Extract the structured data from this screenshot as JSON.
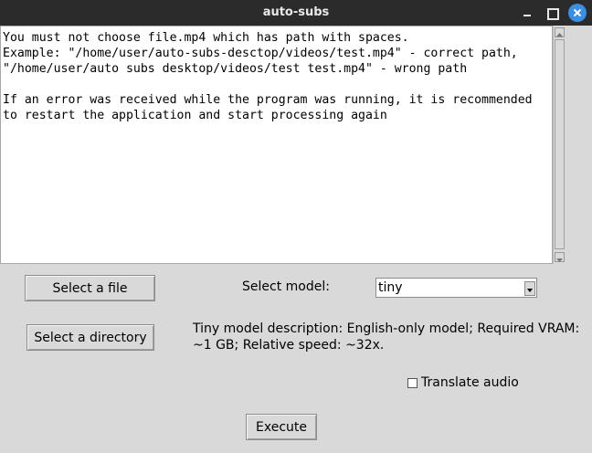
{
  "window": {
    "title": "auto-subs",
    "controls": [
      "minimize-icon",
      "maximize-icon",
      "close-icon"
    ]
  },
  "output_text": "You must not choose file.mp4 which has path with spaces.\nExample: \"/home/user/auto-subs-desctop/videos/test.mp4\" - correct path,\n\"/home/user/auto subs desktop/videos/test test.mp4\" - wrong path\n\nIf an error was received while the program was running, it is recommended\nto restart the application and start processing again",
  "controls": {
    "select_file_label": "Select a file",
    "select_directory_label": "Select a directory",
    "select_model_label": "Select model:",
    "model_value": "tiny",
    "model_description_line1": "Tiny model description: English-only model; Required VRAM:",
    "model_description_line2": "~1 GB; Relative speed: ~32x.",
    "translate_label": "Translate audio",
    "translate_checked": false,
    "execute_label": "Execute"
  }
}
